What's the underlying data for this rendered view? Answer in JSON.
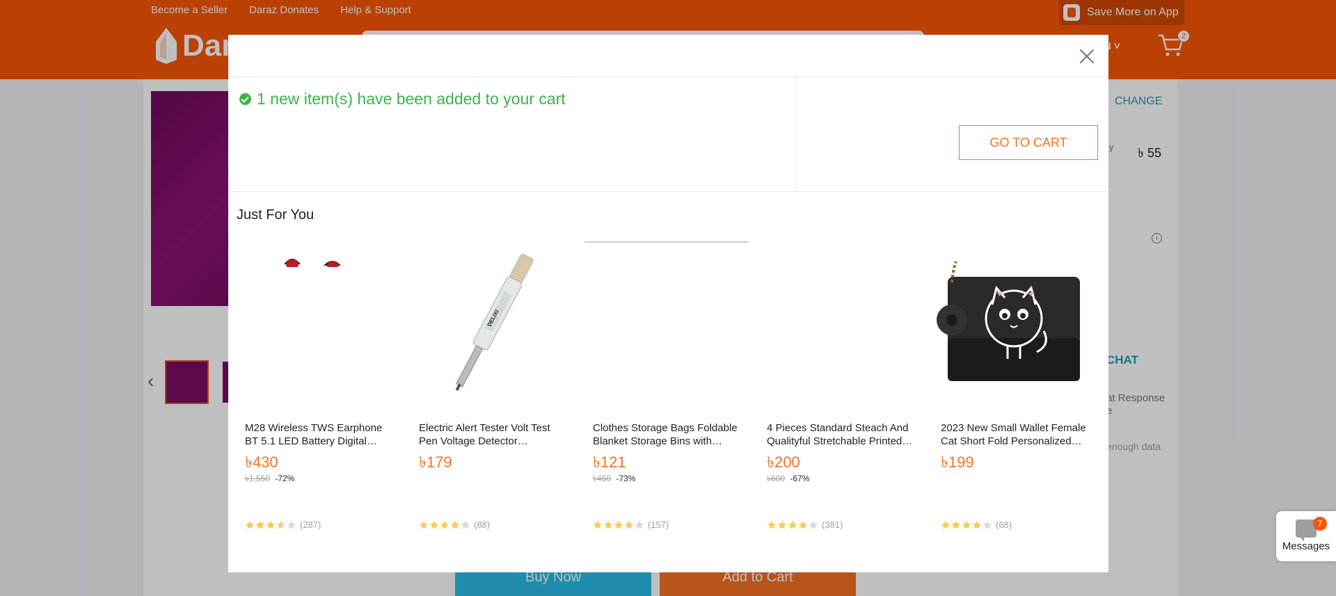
{
  "header": {
    "links": [
      "Become a Seller",
      "Daraz Donates",
      "Help & Support"
    ],
    "app_button": "Save More on App",
    "logo_text": "Daraz",
    "lang_label": "N",
    "cart_count": "2"
  },
  "product_page": {
    "change_label": "CHANGE",
    "price_hint": "y",
    "delivery_price": "৳ 55",
    "chat_label": "CHAT",
    "response_text": "at Response\ne",
    "not_enough_text": "enough data",
    "buy_now": "Buy Now",
    "add_to_cart": "Add to Cart"
  },
  "modal": {
    "added_message": "1 new item(s) have been added to your cart",
    "go_to_cart": "GO TO CART",
    "section_title": "Just For You",
    "products": [
      {
        "name": "M28 Wireless TWS Earphone BT 5.1 LED Battery Digital Display",
        "price": "৳430",
        "original_price": "৳1,550",
        "discount": "-72%",
        "rating_count": "(287)",
        "rating": 3.5,
        "image": "earphone"
      },
      {
        "name": "Electric Alert Tester Volt Test Pen Voltage Detector Screwdriver",
        "price": "৳179",
        "original_price": "",
        "discount": "",
        "rating_count": "(88)",
        "rating": 4,
        "image": "tester-pen"
      },
      {
        "name": "Clothes Storage Bags Foldable Blanket Storage Bins with Handles",
        "price": "৳121",
        "original_price": "৳450",
        "discount": "-73%",
        "rating_count": "(157)",
        "rating": 4,
        "image": "storage-bag"
      },
      {
        "name": "4 Pieces Standard Steach And Qualityful Stretchable Printed Covers",
        "price": "৳200",
        "original_price": "৳600",
        "discount": "-67%",
        "rating_count": "(381)",
        "rating": 4,
        "image": "covers"
      },
      {
        "name": "2023 New Small Wallet Female Cat Short Fold Personalized Purse",
        "price": "৳199",
        "original_price": "",
        "discount": "",
        "rating_count": "(68)",
        "rating": 4,
        "image": "cat-wallet"
      }
    ]
  },
  "messages": {
    "label": "Messages",
    "count": "7"
  },
  "colors": {
    "brand": "#f85606",
    "success": "#3bb44a",
    "price": "#f57224",
    "star": "#faca51",
    "link": "#1a9cb7"
  }
}
